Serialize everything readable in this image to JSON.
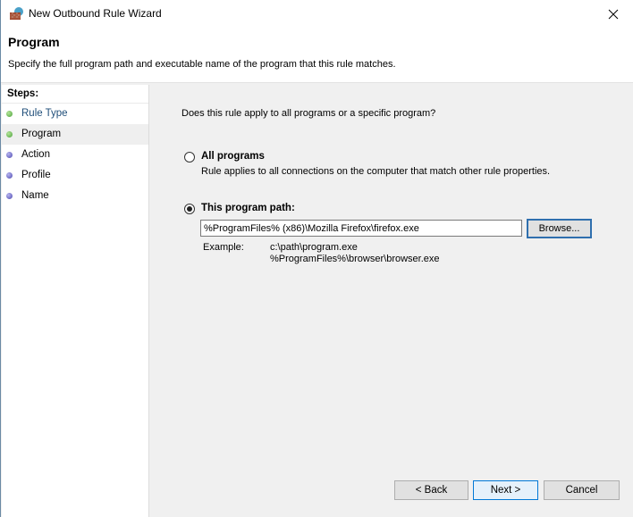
{
  "window": {
    "title": "New Outbound Rule Wizard",
    "icon": "firewall-icon",
    "close_icon": "close-icon"
  },
  "header": {
    "title": "Program",
    "description": "Specify the full program path and executable name of the program that this rule matches."
  },
  "steps": {
    "heading": "Steps:",
    "items": [
      {
        "label": "Rule Type",
        "status": "done"
      },
      {
        "label": "Program",
        "status": "current"
      },
      {
        "label": "Action",
        "status": "pending"
      },
      {
        "label": "Profile",
        "status": "pending"
      },
      {
        "label": "Name",
        "status": "pending"
      }
    ]
  },
  "content": {
    "question": "Does this rule apply to all programs or a specific program?",
    "options": [
      {
        "label": "All programs",
        "description": "Rule applies to all connections on the computer that match other rule properties.",
        "selected": false
      },
      {
        "label": "This program path:",
        "selected": true
      }
    ],
    "path_value": "%ProgramFiles% (x86)\\Mozilla Firefox\\firefox.exe",
    "browse_label": "Browse...",
    "example_label": "Example:",
    "example_values": [
      "c:\\path\\program.exe",
      "%ProgramFiles%\\browser\\browser.exe"
    ]
  },
  "footer": {
    "back_label": "< Back",
    "next_label": "Next >",
    "cancel_label": "Cancel"
  }
}
